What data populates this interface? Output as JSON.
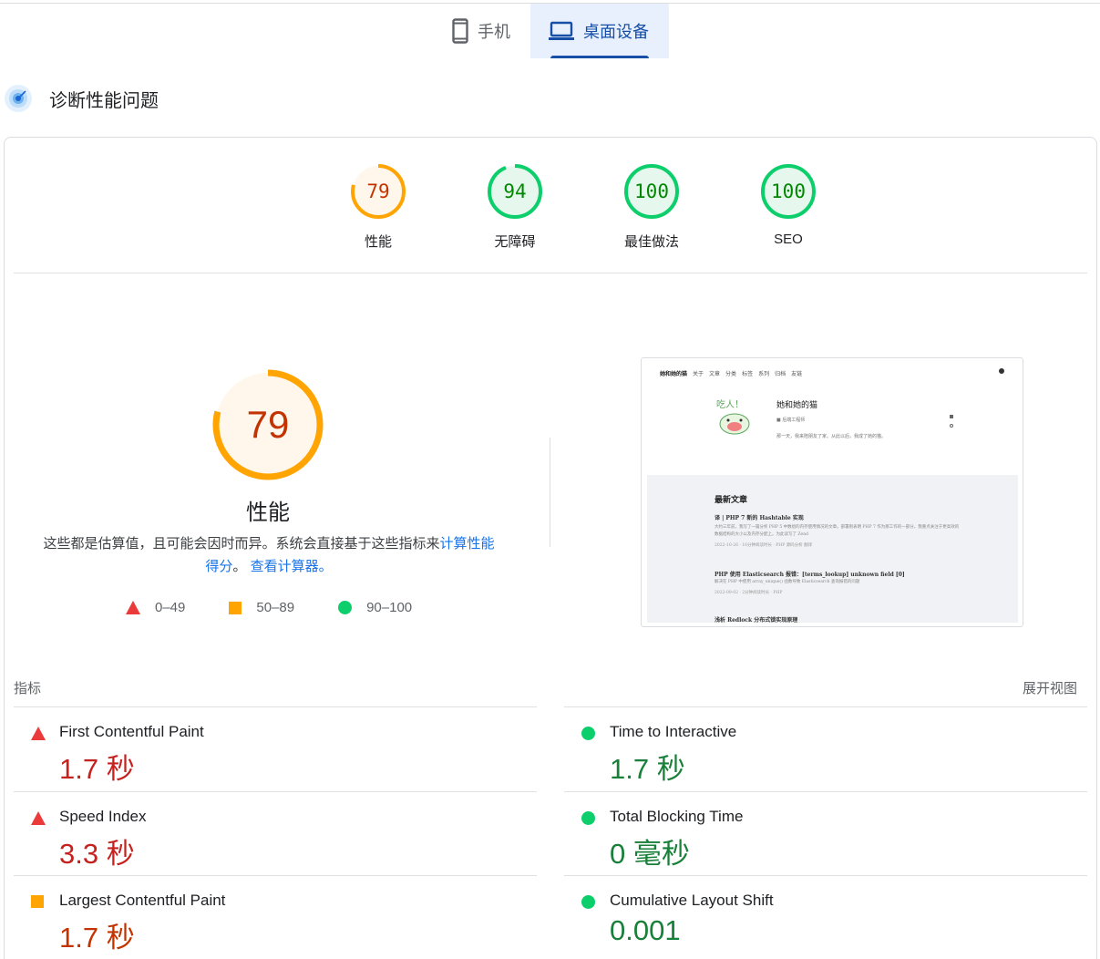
{
  "device_tabs": [
    {
      "label": "手机",
      "icon": "smartphone-icon",
      "active": false
    },
    {
      "label": "桌面设备",
      "icon": "laptop-icon",
      "active": true
    }
  ],
  "section": {
    "title": "诊断性能问题",
    "icon": "diagnose-icon"
  },
  "gauges": [
    {
      "value": "79",
      "label": "性能",
      "score": 79,
      "color": "#ffa400"
    },
    {
      "value": "94",
      "label": "无障碍",
      "score": 94,
      "color": "#0cce6b"
    },
    {
      "value": "100",
      "label": "最佳做法",
      "score": 100,
      "color": "#0cce6b"
    },
    {
      "value": "100",
      "label": "SEO",
      "score": 100,
      "color": "#0cce6b"
    }
  ],
  "performance": {
    "score": "79",
    "title": "性能",
    "desc_prefix": "这些都是估算值，且可能会因时而异。系统会直接基于这些指标来",
    "desc_link1": "计算性能得分",
    "desc_middle": "。",
    "desc_link2": "查看计算器。"
  },
  "legend": [
    {
      "label": "0–49",
      "shape": "triangle",
      "color": "#eb3a3a"
    },
    {
      "label": "50–89",
      "shape": "square",
      "color": "#ffa400"
    },
    {
      "label": "90–100",
      "shape": "circle",
      "color": "#0cce6b"
    }
  ],
  "thumbnail": {
    "brand": "她和她的猫",
    "nav": [
      "关于",
      "文章",
      "分类",
      "标签",
      "系列",
      "归档",
      "友链"
    ],
    "avatar_text": "吃人！",
    "name": "她和她的猫",
    "meta": "后端工程师",
    "bio": "那一天，我来陪朋友了家。从此以后，我成了她的猫。",
    "latest_heading": "最新文章",
    "posts": [
      {
        "title": "译 | PHP 7 新的 Hashtable 实现",
        "text": "大约三年前，我写了一篇分析 PHP 5 中数组的内存使用情况的文章。部署则表明 PHP 7 作为那工作的一部分，我重点关注于更高效的数据结构的大小以及内存分配上。为此读写了 Zend",
        "meta": "2022-10-26 · 16分钟阅读时长 · PHP 源码分析 翻译"
      },
      {
        "title": "PHP 使用 Elasticsearch 报错：[terms_lookup] unknown field [0]",
        "text": "解决在 PHP 中使用 array_unique() 函数导致 Elasticsearch 查询报错的问题",
        "meta": "2022-09-02 · 2分钟阅读时长 · PHP"
      },
      {
        "title": "浅析 Redlock 分布式锁实现原理",
        "text": "",
        "meta": ""
      }
    ]
  },
  "metrics_header": {
    "label": "指标",
    "expand": "展开视图"
  },
  "metrics": [
    {
      "name": "First Contentful Paint",
      "value": "1.7 秒",
      "rating": "fail"
    },
    {
      "name": "Time to Interactive",
      "value": "1.7 秒",
      "rating": "pass"
    },
    {
      "name": "Speed Index",
      "value": "3.3 秒",
      "rating": "fail"
    },
    {
      "name": "Total Blocking Time",
      "value": "0 毫秒",
      "rating": "pass"
    },
    {
      "name": "Largest Contentful Paint",
      "value": "1.7 秒",
      "rating": "average"
    },
    {
      "name": "Cumulative Layout Shift",
      "value": "0.001",
      "rating": "pass"
    }
  ]
}
